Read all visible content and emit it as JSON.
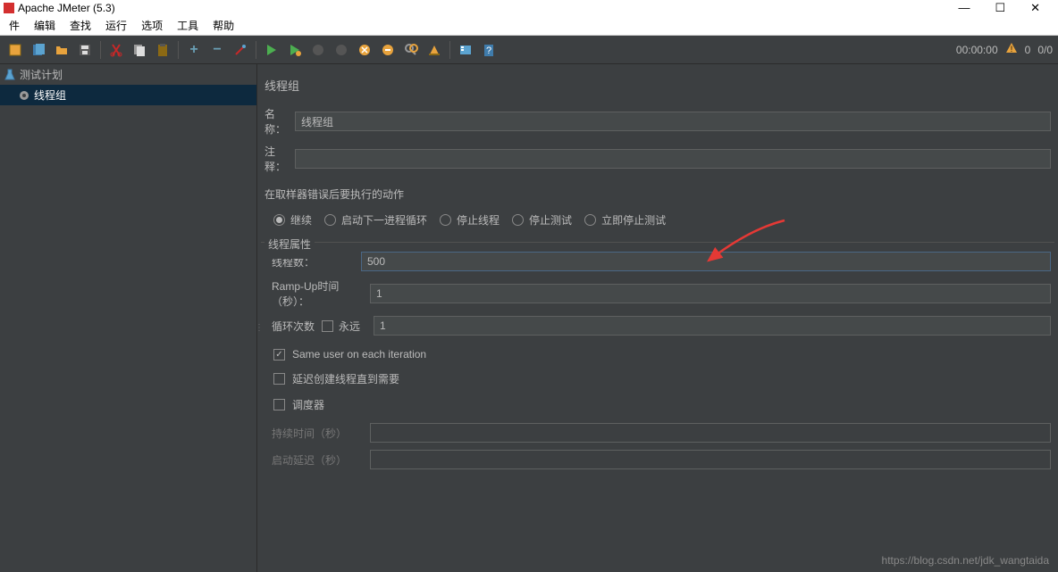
{
  "titlebar": {
    "title": "Apache JMeter (5.3)"
  },
  "menu": {
    "file": "件",
    "edit": "编辑",
    "search": "查找",
    "run": "运行",
    "options": "选项",
    "tools": "工具",
    "help": "帮助"
  },
  "toolbar_right": {
    "time": "00:00:00",
    "warning_count": "0",
    "thread_count": "0/0"
  },
  "tree": {
    "root": "测试计划",
    "child": "线程组"
  },
  "panel": {
    "title": "线程组",
    "name_label": "名称：",
    "name_value": "线程组",
    "comment_label": "注释：",
    "comment_value": "",
    "error_section": "在取样器错误后要执行的动作",
    "radios": {
      "continue": "继续",
      "start_next": "启动下一进程循环",
      "stop_thread": "停止线程",
      "stop_test": "停止测试",
      "stop_now": "立即停止测试"
    },
    "thread_props": "线程属性",
    "threads_label": "线程数：",
    "threads_value": "500",
    "rampup_label": "Ramp-Up时间（秒）：",
    "rampup_value": "1",
    "loop_label": "循环次数",
    "forever_label": "永远",
    "loop_value": "1",
    "same_user": "Same user on each iteration",
    "delay_create": "延迟创建线程直到需要",
    "scheduler": "调度器",
    "duration_label": "持续时间（秒）",
    "delay_label": "启动延迟（秒）"
  },
  "watermark": "https://blog.csdn.net/jdk_wangtaida"
}
